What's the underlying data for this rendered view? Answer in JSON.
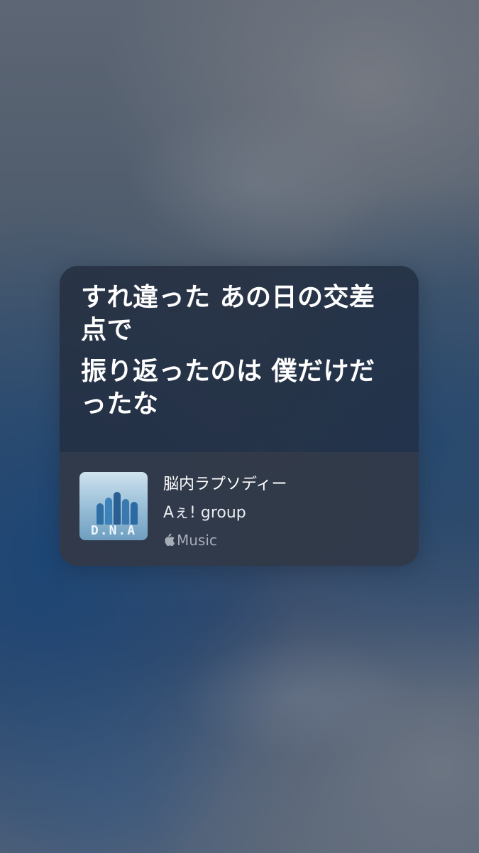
{
  "lyrics": {
    "lines": [
      "すれ違った あの日の交差点で",
      "振り返ったのは 僕だけだったな"
    ]
  },
  "track": {
    "title": "脳内ラプソディー",
    "artist": "Aぇ! group",
    "service_label": "Music",
    "service_icon": "apple-logo-icon",
    "cover_text": "D.N.A"
  }
}
